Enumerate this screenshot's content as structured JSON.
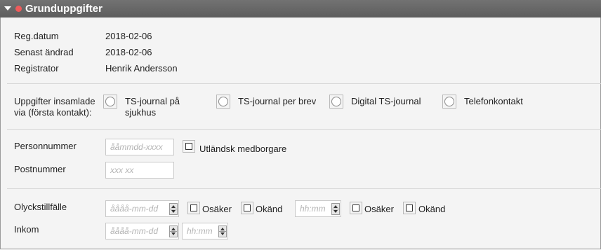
{
  "header": {
    "title": "Grunduppgifter"
  },
  "meta": [
    {
      "label": "Reg.datum",
      "value": "2018-02-06"
    },
    {
      "label": "Senast ändrad",
      "value": "2018-02-06"
    },
    {
      "label": "Registrator",
      "value": "Henrik Andersson"
    }
  ],
  "collection": {
    "label_line1": "Uppgifter insamlade",
    "label_line2": "via (första kontakt):",
    "options": [
      {
        "line1": "TS-journal på",
        "line2": "sjukhus"
      },
      {
        "line1": "TS-journal per brev"
      },
      {
        "line1": "Digital TS-journal"
      },
      {
        "line1": "Telefonkontakt"
      }
    ]
  },
  "person": {
    "personnummer_label": "Personnummer",
    "personnummer_placeholder": "ååmmdd-xxxx",
    "foreign_label": "Utländsk medborgare",
    "postnummer_label": "Postnummer",
    "postnummer_placeholder": "xxx xx"
  },
  "accident": {
    "label": "Olyckstillfälle",
    "date_placeholder": "åååå-mm-dd",
    "unsure_label": "Osäker",
    "unknown_label": "Okänd",
    "time_placeholder": "hh:mm",
    "time_unsure_label": "Osäker",
    "time_unknown_label": "Okänd"
  },
  "income": {
    "label": "Inkom",
    "date_placeholder": "åååå-mm-dd",
    "time_placeholder": "hh:mm"
  }
}
